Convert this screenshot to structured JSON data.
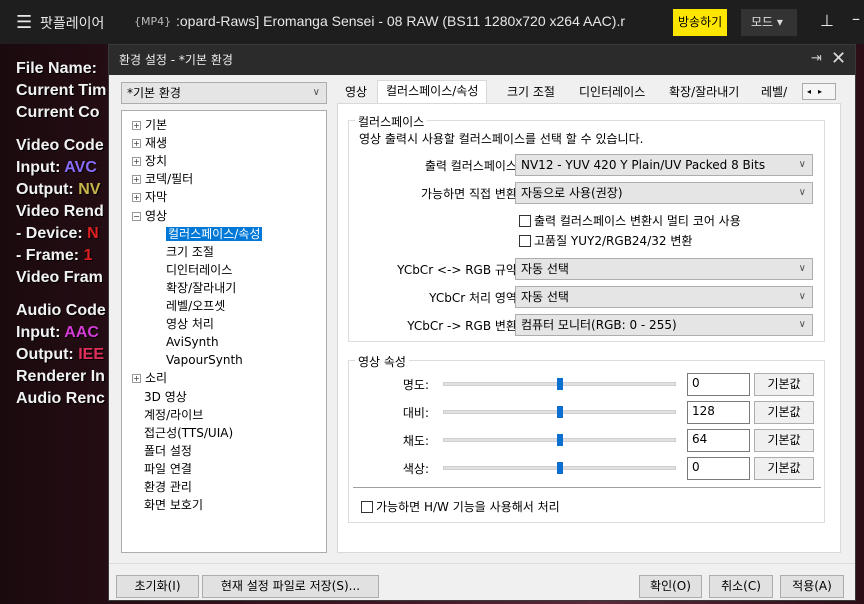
{
  "topbar": {
    "app_name": "팟플레이어",
    "format": "{MP4}",
    "file_title": ":opard-Raws] Eromanga Sensei - 08 RAW (BS11 1280x720 x264 AAC).r",
    "broadcast_label": "방송하기",
    "mode_label": "모드"
  },
  "osd": [
    {
      "label": "File Name:",
      "value": ""
    },
    {
      "label": "Current Tim",
      "value": ""
    },
    {
      "label": "Current Co",
      "value": ""
    },
    {
      "label": "Video Code",
      "value": ""
    },
    {
      "label": "Input: ",
      "value": "AVC"
    },
    {
      "label": "Output: ",
      "value": "NV"
    },
    {
      "label": "Video Rend",
      "value": ""
    },
    {
      "label": " - Device: ",
      "value": "N"
    },
    {
      "label": " - Frame: ",
      "value": "1"
    },
    {
      "label": "Video Fram",
      "value": ""
    },
    {
      "label": "Audio Code",
      "value": ""
    },
    {
      "label": "Input: ",
      "value": "AAC"
    },
    {
      "label": "Output: ",
      "value": "IEE"
    },
    {
      "label": "Renderer In",
      "value": ""
    },
    {
      "label": "Audio Renc",
      "value": ""
    }
  ],
  "colors": {
    "avc": "#8b6cff",
    "nv": "#c9b44a",
    "red": "#e02020",
    "aac": "#d43ad4",
    "iee": "#e0305a",
    "accent": "#0078d7",
    "broadcast": "#ffe600"
  },
  "dialog": {
    "title": "환경 설정 - *기본 환경",
    "preset": "*기본 환경",
    "tree": [
      {
        "label": "기본",
        "exp": "+",
        "lvl": 0
      },
      {
        "label": "재생",
        "exp": "+",
        "lvl": 0
      },
      {
        "label": "장치",
        "exp": "+",
        "lvl": 0
      },
      {
        "label": "코덱/필터",
        "exp": "+",
        "lvl": 0
      },
      {
        "label": "자막",
        "exp": "+",
        "lvl": 0
      },
      {
        "label": "영상",
        "exp": "-",
        "lvl": 0
      },
      {
        "label": "컬러스페이스/속성",
        "lvl": 1,
        "selected": true
      },
      {
        "label": "크기 조절",
        "lvl": 1
      },
      {
        "label": "디인터레이스",
        "lvl": 1
      },
      {
        "label": "확장/잘라내기",
        "lvl": 1
      },
      {
        "label": "레벨/오프셋",
        "lvl": 1
      },
      {
        "label": "영상 처리",
        "lvl": 1
      },
      {
        "label": "AviSynth",
        "lvl": 1
      },
      {
        "label": "VapourSynth",
        "lvl": 1
      },
      {
        "label": "소리",
        "exp": "+",
        "lvl": 0
      },
      {
        "label": "3D 영상",
        "lvl": 0
      },
      {
        "label": "계정/라이브",
        "lvl": 0
      },
      {
        "label": "접근성(TTS/UIA)",
        "lvl": 0
      },
      {
        "label": "폴더 설정",
        "lvl": 0
      },
      {
        "label": "파일 연결",
        "lvl": 0
      },
      {
        "label": "환경 관리",
        "lvl": 0
      },
      {
        "label": "화면 보호기",
        "lvl": 0
      }
    ],
    "tabs": [
      "영상",
      "컬러스페이스/속성",
      "크기 조절",
      "디인터레이스",
      "확장/잘라내기",
      "레벨/"
    ],
    "colorspace": {
      "group": "컬러스페이스",
      "desc": "영상 출력시 사용할 컬러스페이스를 선택 할 수 있습니다.",
      "rows": [
        {
          "label": "출력 컬러스페이스:",
          "value": "NV12 - YUV 420 Y Plain/UV Packed 8 Bits"
        },
        {
          "label": "가능하면 직접 변환:",
          "value": "자동으로 사용(권장)"
        }
      ],
      "checks": [
        "출력 컬러스페이스 변환시 멀티 코어 사용",
        "고품질 YUY2/RGB24/32 변환"
      ],
      "rows2": [
        {
          "label": "YCbCr <-> RGB 규약:",
          "value": "자동 선택"
        },
        {
          "label": "YCbCr 처리 영역:",
          "value": "자동 선택"
        },
        {
          "label": "YCbCr -> RGB 변환:",
          "value": "컴퓨터 모니터(RGB: 0 - 255)"
        }
      ]
    },
    "props": {
      "group": "영상 속성",
      "default_label": "기본값",
      "hw_check": "가능하면 H/W 기능을 사용해서 처리",
      "sliders": [
        {
          "label": "명도:",
          "value": "0",
          "pos": 0.5
        },
        {
          "label": "대비:",
          "value": "128",
          "pos": 0.5
        },
        {
          "label": "채도:",
          "value": "64",
          "pos": 0.5
        },
        {
          "label": "색상:",
          "value": "0",
          "pos": 0.5
        }
      ]
    },
    "buttons": {
      "reset": "초기화(I)",
      "save": "현재 설정 파일로 저장(S)...",
      "ok": "확인(O)",
      "cancel": "취소(C)",
      "apply": "적용(A)"
    }
  }
}
